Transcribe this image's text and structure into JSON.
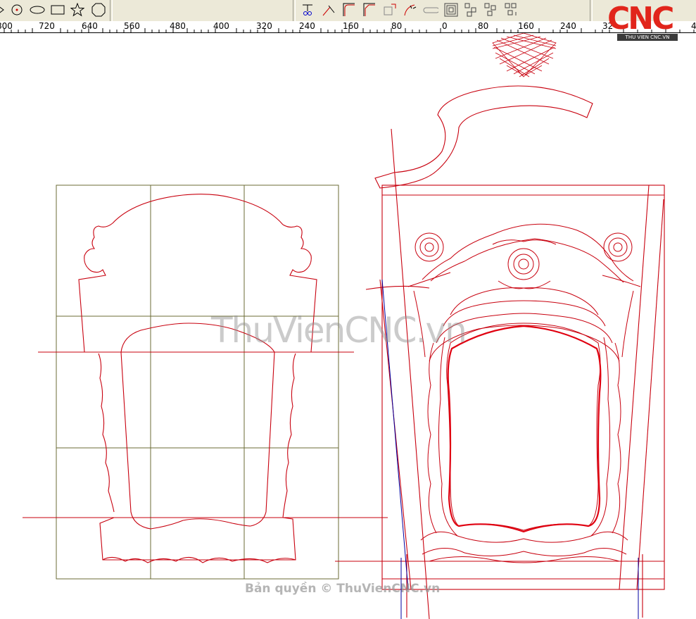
{
  "ruler": {
    "labels": [
      "800",
      "720",
      "640",
      "560",
      "480",
      "400",
      "320",
      "240",
      "160",
      "80",
      "0",
      "80",
      "160",
      "240",
      "32",
      "4"
    ]
  },
  "toolbar": {
    "tools": [
      {
        "name": "polyline-arrow-tool",
        "icon": "arrow-icon"
      },
      {
        "name": "point-tool",
        "icon": "circle-point-icon"
      },
      {
        "name": "ellipse-tool",
        "icon": "ellipse-icon"
      },
      {
        "name": "rectangle-tool",
        "icon": "rectangle-icon"
      },
      {
        "name": "star-tool",
        "icon": "star-icon"
      },
      {
        "name": "polygon-tool",
        "icon": "octagon-icon"
      },
      {
        "name": "trim-tool",
        "icon": "scissors-icon"
      },
      {
        "name": "extend-tool",
        "icon": "extend-icon"
      },
      {
        "name": "fillet-tool",
        "icon": "fillet-icon"
      },
      {
        "name": "chamfer-tool",
        "icon": "chamfer-icon"
      },
      {
        "name": "corner-tool",
        "icon": "corner-icon"
      },
      {
        "name": "blend-tool",
        "icon": "blend-icon"
      },
      {
        "name": "slot-tool",
        "icon": "slot-icon"
      },
      {
        "name": "offset-tool",
        "icon": "offset-icon"
      },
      {
        "name": "array-tool",
        "icon": "array-icon"
      },
      {
        "name": "copy-tool",
        "icon": "copy-icon"
      },
      {
        "name": "move-tool",
        "icon": "move-icon"
      }
    ]
  },
  "logo": {
    "text": "CNC",
    "subtitle": "THU VIEN CNC.VN"
  },
  "watermark": {
    "text": "ThuVienCNC.vn"
  },
  "copyright": {
    "text": "Bản quyền © ThuVienCNC.vn"
  },
  "colors": {
    "drawing": "#c8000e",
    "grid": "#6b6b36",
    "guide": "#0000a0",
    "toolbar_bg": "#ece9d8"
  }
}
